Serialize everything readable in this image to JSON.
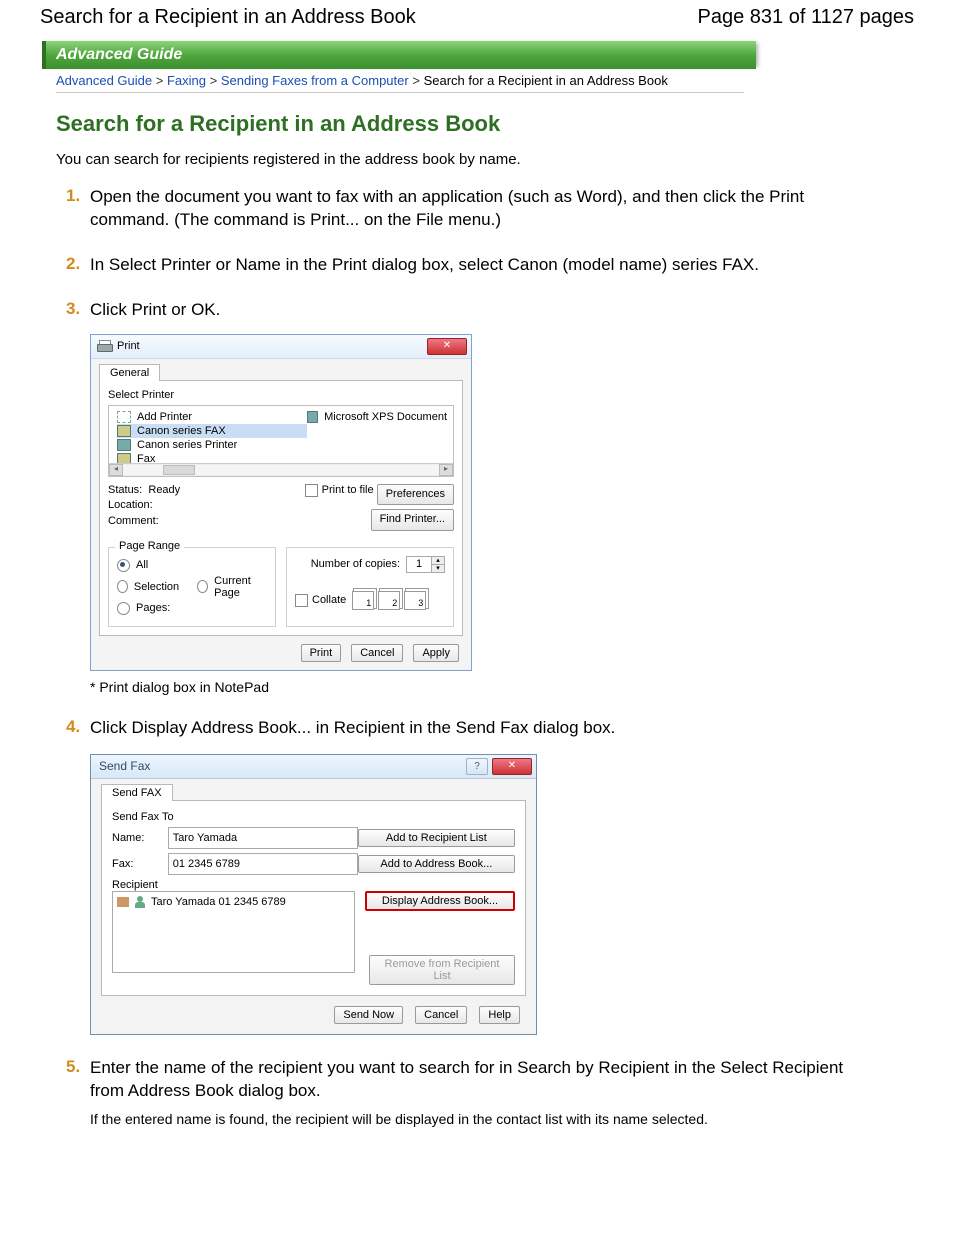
{
  "header": {
    "title": "Search for a Recipient in an Address Book",
    "page_info": "Page 831 of 1127 pages"
  },
  "guide_bar": "Advanced Guide",
  "breadcrumbs": {
    "a": "Advanced Guide",
    "b": "Faxing",
    "c": "Sending Faxes from a Computer",
    "d": "Search for a Recipient in an Address Book",
    "sep": ">"
  },
  "h1": "Search for a Recipient in an Address Book",
  "intro": "You can search for recipients registered in the address book by name.",
  "steps": {
    "s1": "Open the document you want to fax with an application (such as Word), and then click the Print command. (The command is Print... on the File menu.)",
    "s2": "In Select Printer or Name in the Print dialog box, select Canon (model name) series FAX.",
    "s3": "Click Print or OK.",
    "s4": "Click Display Address Book... in Recipient in the Send Fax dialog box.",
    "s5": "Enter the name of the recipient you want to search for in Search by Recipient in the Select Recipient from Address Book dialog box.",
    "s5_sub": "If the entered name is found, the recipient will be displayed in the contact list with its name selected."
  },
  "print_dialog": {
    "title": "Print",
    "tab": "General",
    "select_printer_label": "Select Printer",
    "printers": {
      "add": "Add Printer",
      "fax_sel": "Canon            series FAX",
      "printer": "Canon            series Printer",
      "fax": "Fax",
      "ms": "Microsoft XPS Document"
    },
    "status_label": "Status:",
    "status_value": "Ready",
    "location_label": "Location:",
    "comment_label": "Comment:",
    "print_to_file": "Print to file",
    "preferences_btn": "Preferences",
    "find_printer_btn": "Find Printer...",
    "page_range_legend": "Page Range",
    "radio_all": "All",
    "radio_selection": "Selection",
    "radio_current": "Current Page",
    "radio_pages": "Pages:",
    "copies_label": "Number of copies:",
    "copies_value": "1",
    "collate_label": "Collate",
    "collate_1": "1",
    "collate_2": "2",
    "collate_3": "3",
    "btn_print": "Print",
    "btn_cancel": "Cancel",
    "btn_apply": "Apply",
    "caption": "* Print dialog box in NotePad"
  },
  "sendfax_dialog": {
    "title": "Send Fax",
    "tab": "Send FAX",
    "group_to": "Send Fax To",
    "name_label": "Name:",
    "name_value": "Taro Yamada",
    "fax_label": "Fax:",
    "fax_value": "01 2345 6789",
    "btn_add_recipient": "Add to Recipient List",
    "btn_add_addressbook": "Add to Address Book...",
    "recipient_label": "Recipient",
    "recipient_row": "Taro Yamada   01 2345 6789",
    "btn_display_address": "Display Address Book...",
    "btn_remove": "Remove from Recipient List",
    "btn_send": "Send Now",
    "btn_cancel": "Cancel",
    "btn_help": "Help"
  }
}
